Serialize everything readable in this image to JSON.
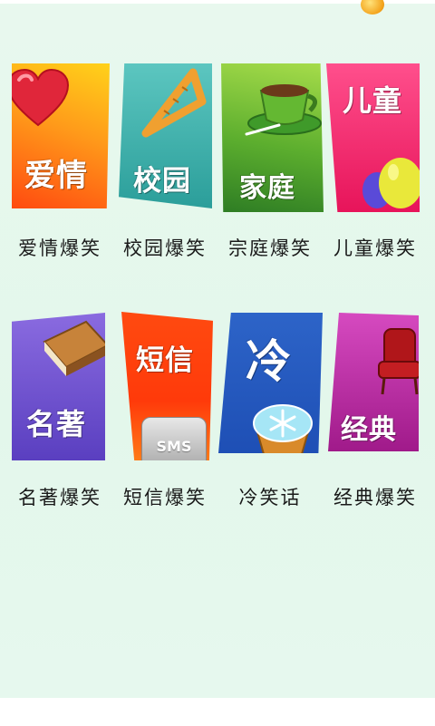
{
  "categories": [
    {
      "tile_label": "爱情",
      "caption": "爱情爆笑",
      "icon": "heart-icon",
      "colors": [
        "#ff5a1c",
        "#ffc21a"
      ]
    },
    {
      "tile_label": "校园",
      "caption": "校园爆笑",
      "icon": "ruler-icon",
      "colors": [
        "#2f9e9a",
        "#5ec9c3"
      ]
    },
    {
      "tile_label": "家庭",
      "caption": "宗庭爆笑",
      "icon": "coffee-cup-icon",
      "colors": [
        "#2e8a2e",
        "#8fd23e"
      ]
    },
    {
      "tile_label": "儿童",
      "caption": "儿童爆笑",
      "icon": "balloons-icon",
      "colors": [
        "#e7145a",
        "#ff4f8c"
      ]
    },
    {
      "tile_label": "名著",
      "caption": "名著爆笑",
      "icon": "books-icon",
      "colors": [
        "#5a3fc0",
        "#8a6be0"
      ]
    },
    {
      "tile_label": "短信",
      "caption": "短信爆笑",
      "icon": "sms-phone-icon",
      "colors": [
        "#ff3a0a",
        "#ff8a1a"
      ]
    },
    {
      "tile_label": "冷",
      "caption": "冷笑话",
      "icon": "snowflake-cupcake-icon",
      "colors": [
        "#1e4fb5",
        "#4a86e6"
      ]
    },
    {
      "tile_label": "经典",
      "caption": "经典爆笑",
      "icon": "armchair-icon",
      "colors": [
        "#a01a8a",
        "#d64ac0"
      ]
    }
  ],
  "sms_text": "SMS"
}
